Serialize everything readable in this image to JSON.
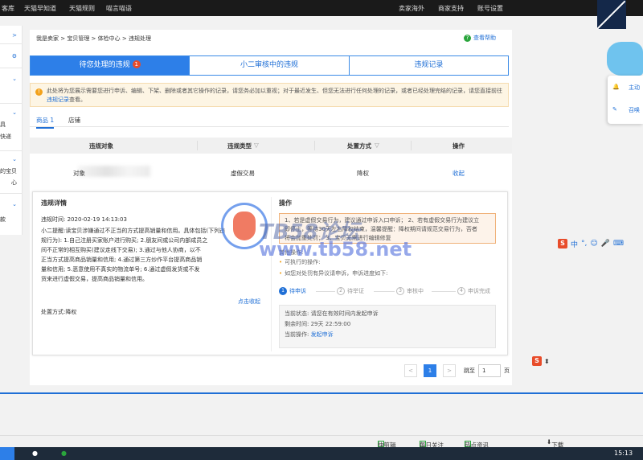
{
  "topbar": {
    "left_items": [
      "客库",
      "天猫早知道",
      "天猫规则",
      "喵言喵语"
    ],
    "right_items": [
      "卖家海外",
      "商家支持",
      "账号设置"
    ]
  },
  "sidebar": {
    "fragments": [
      "具",
      "快递",
      "的宝贝",
      "心",
      "款"
    ]
  },
  "breadcrumb": "我是卖家 > 宝贝管理 > 体检中心 > 违规处理",
  "help_label": "查看帮助",
  "tabs": [
    {
      "label": "待您处理的违规",
      "badge": "1"
    },
    {
      "label": "小二审核中的违规"
    },
    {
      "label": "违规记录"
    }
  ],
  "notice": {
    "text": "此处将为您展示需要您进行申诉、编辑、下架、删除或者其它操作的记录，请您务必加以重视；对于最近发生、但您无法进行任何处理的记录，或者已经处理完结的记录，请您直接前往",
    "link": "违规记录",
    "suffix": "查看。"
  },
  "subtabs": {
    "goods": "商品 1",
    "shop": "店铺"
  },
  "table": {
    "headers": {
      "object": "违规对象",
      "type": "违规类型",
      "method": "处置方式",
      "action": "操作"
    },
    "row": {
      "object": "对象",
      "type": "虚假交易",
      "method": "降权",
      "action": "收起"
    }
  },
  "detail": {
    "title": "违规详情",
    "time_label": "违规时间:",
    "time_value": "2020-02-19 14:13:03",
    "reminder_label": "小二提醒:",
    "reminder_lines": [
      "读宝贝涉嫌通过不正当的方式提高销量和信用。具体包括(下列违",
      "规行为): 1.自己注册买家账户进行购买; 2.朋友间或公司内部成员之",
      "间不正常的相互购买(建议走线下交易); 3.通过与他人协商，以不",
      "正当方式提高商品销量和信用; 4.通过第三方炒作平台提高商品销",
      "量和信用; 5.恶意使用不真实的物流单号; 6.通过虚假发货或不发",
      "货来进行虚假交易，提高商品销量和信用。"
    ],
    "collapse": "点击收起",
    "method_label": "处置方式:",
    "method_value": "降权"
  },
  "operation": {
    "title": "操作",
    "box_lines": [
      "1、若是虚假交易行为，建议通过申诉入口申诉； 2、若有虚假交易行为建议立",
      "即停止，等待30天左右降权结束，温馨提醒：降权期间请规范交易行为，否者",
      "将会加重处罚； 3、宝贝无需进行编辑修复"
    ],
    "other_label": "其他操作:",
    "executable": "可执行的操作:",
    "appeal_note": "如您对处罚有异议请申诉，申诉进度如下:",
    "steps": [
      {
        "n": "1",
        "label": "待申诉"
      },
      {
        "n": "2",
        "label": "待举证"
      },
      {
        "n": "3",
        "label": "审核中"
      },
      {
        "n": "4",
        "label": "申诉完成"
      }
    ],
    "status_label": "当前状态:",
    "status_value": "请您在有效时间内发起申诉",
    "remain_label": "剩余时间:",
    "remain_value": "29天 22:59:00",
    "current_op_label": "当前操作:",
    "current_op_link": "发起申诉"
  },
  "pager": {
    "current": "1",
    "goto_label": "跳至",
    "goto_value": "1",
    "page_unit": "页",
    "prev": "<",
    "next": ">"
  },
  "watermark": {
    "line1": "TB58论坛",
    "line2": "www.tb58.net"
  },
  "right_panel": {
    "item1": "主动",
    "item2": "召唤"
  },
  "ime": {
    "label": "中",
    "punct": "°,"
  },
  "statusbar": {
    "items": [
      "快剪辑",
      "每日关注",
      "热点资讯",
      "下载"
    ]
  },
  "taskbar": {
    "time": "15:13"
  }
}
